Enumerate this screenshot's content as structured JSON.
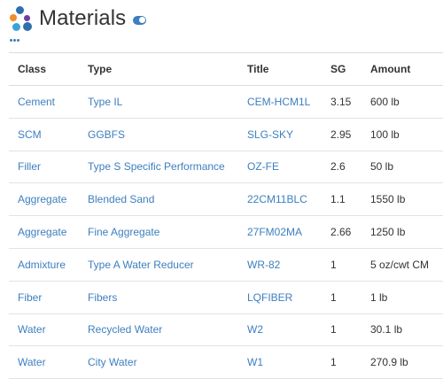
{
  "page": {
    "title": "Materials"
  },
  "colors": {
    "link": "#3d7fbf",
    "logo": [
      "#2f6fad",
      "#f28c28",
      "#6c3fa0",
      "#3ba3dc"
    ]
  },
  "icons": {
    "logo": "materials-logo-icon",
    "toggle": "toggle-icon",
    "more": "more-dots-icon"
  },
  "table": {
    "headers": [
      "Class",
      "Type",
      "Title",
      "SG",
      "Amount"
    ],
    "rows": [
      {
        "class": "Cement",
        "type": "Type IL",
        "title": "CEM-HCM1L",
        "sg": "3.15",
        "amount": "600 lb"
      },
      {
        "class": "SCM",
        "type": "GGBFS",
        "title": "SLG-SKY",
        "sg": "2.95",
        "amount": "100 lb"
      },
      {
        "class": "Filler",
        "type": "Type S Specific Performance",
        "title": "OZ-FE",
        "sg": "2.6",
        "amount": "50 lb"
      },
      {
        "class": "Aggregate",
        "type": "Blended Sand",
        "title": "22CM11BLC",
        "sg": "1.1",
        "amount": "1550 lb"
      },
      {
        "class": "Aggregate",
        "type": "Fine Aggregate",
        "title": "27FM02MA",
        "sg": "2.66",
        "amount": "1250 lb"
      },
      {
        "class": "Admixture",
        "type": "Type A Water Reducer",
        "title": "WR-82",
        "sg": "1",
        "amount": "5 oz/cwt CM"
      },
      {
        "class": "Fiber",
        "type": "Fibers",
        "title": "LQFIBER",
        "sg": "1",
        "amount": "1 lb"
      },
      {
        "class": "Water",
        "type": "Recycled Water",
        "title": "W2",
        "sg": "1",
        "amount": "30.1 lb"
      },
      {
        "class": "Water",
        "type": "City Water",
        "title": "W1",
        "sg": "1",
        "amount": "270.9 lb"
      }
    ]
  }
}
